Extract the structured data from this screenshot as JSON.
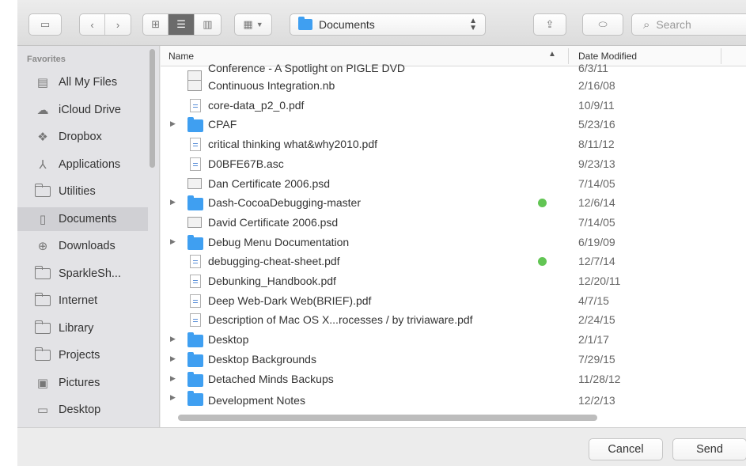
{
  "toolbar": {
    "path": "Documents",
    "search_placeholder": "Search"
  },
  "sidebar": {
    "heading": "Favorites",
    "items": [
      {
        "label": "All My Files",
        "icon": "all-files-icon"
      },
      {
        "label": "iCloud Drive",
        "icon": "cloud-icon"
      },
      {
        "label": "Dropbox",
        "icon": "dropbox-icon"
      },
      {
        "label": "Applications",
        "icon": "applications-icon"
      },
      {
        "label": "Utilities",
        "icon": "folder-icon"
      },
      {
        "label": "Documents",
        "icon": "documents-icon",
        "selected": true
      },
      {
        "label": "Downloads",
        "icon": "downloads-icon"
      },
      {
        "label": "SparkleSh...",
        "icon": "folder-icon"
      },
      {
        "label": "Internet",
        "icon": "folder-icon"
      },
      {
        "label": "Library",
        "icon": "folder-icon"
      },
      {
        "label": "Projects",
        "icon": "folder-icon"
      },
      {
        "label": "Pictures",
        "icon": "pictures-icon"
      },
      {
        "label": "Desktop",
        "icon": "desktop-icon"
      }
    ]
  },
  "list": {
    "columns": {
      "name": "Name",
      "date": "Date Modified"
    },
    "rows": [
      {
        "name": "Conference - A Spotlight on PIGLE DVD",
        "date": "6/3/11",
        "kind": "image"
      },
      {
        "name": "Continuous Integration.nb",
        "date": "2/16/08",
        "kind": "image"
      },
      {
        "name": "core-data_p2_0.pdf",
        "date": "10/9/11",
        "kind": "doc"
      },
      {
        "name": "CPAF",
        "date": "5/23/16",
        "kind": "folder"
      },
      {
        "name": "critical thinking what&why2010.pdf",
        "date": "8/11/12",
        "kind": "doc"
      },
      {
        "name": "D0BFE67B.asc",
        "date": "9/23/13",
        "kind": "doc"
      },
      {
        "name": "Dan Certificate 2006.psd",
        "date": "7/14/05",
        "kind": "image"
      },
      {
        "name": "Dash-CocoaDebugging-master",
        "date": "12/6/14",
        "kind": "folder",
        "tag": "green"
      },
      {
        "name": "David Certificate 2006.psd",
        "date": "7/14/05",
        "kind": "image"
      },
      {
        "name": "Debug Menu Documentation",
        "date": "6/19/09",
        "kind": "folder"
      },
      {
        "name": "debugging-cheat-sheet.pdf",
        "date": "12/7/14",
        "kind": "doc",
        "tag": "green"
      },
      {
        "name": "Debunking_Handbook.pdf",
        "date": "12/20/11",
        "kind": "doc"
      },
      {
        "name": "Deep Web-Dark Web(BRIEF).pdf",
        "date": "4/7/15",
        "kind": "doc"
      },
      {
        "name": "Description of Mac OS X...rocesses / by triviaware.pdf",
        "date": "2/24/15",
        "kind": "doc"
      },
      {
        "name": "Desktop",
        "date": "2/1/17",
        "kind": "folder"
      },
      {
        "name": "Desktop Backgrounds",
        "date": "7/29/15",
        "kind": "folder"
      },
      {
        "name": "Detached Minds Backups",
        "date": "11/28/12",
        "kind": "folder"
      },
      {
        "name": "Development Notes",
        "date": "12/2/13",
        "kind": "folder"
      }
    ]
  },
  "buttons": {
    "cancel": "Cancel",
    "send": "Send"
  },
  "colors": {
    "folder": "#3f9ff1",
    "tag_green": "#62c554",
    "sidebar_selected": "#d0d0d4"
  }
}
